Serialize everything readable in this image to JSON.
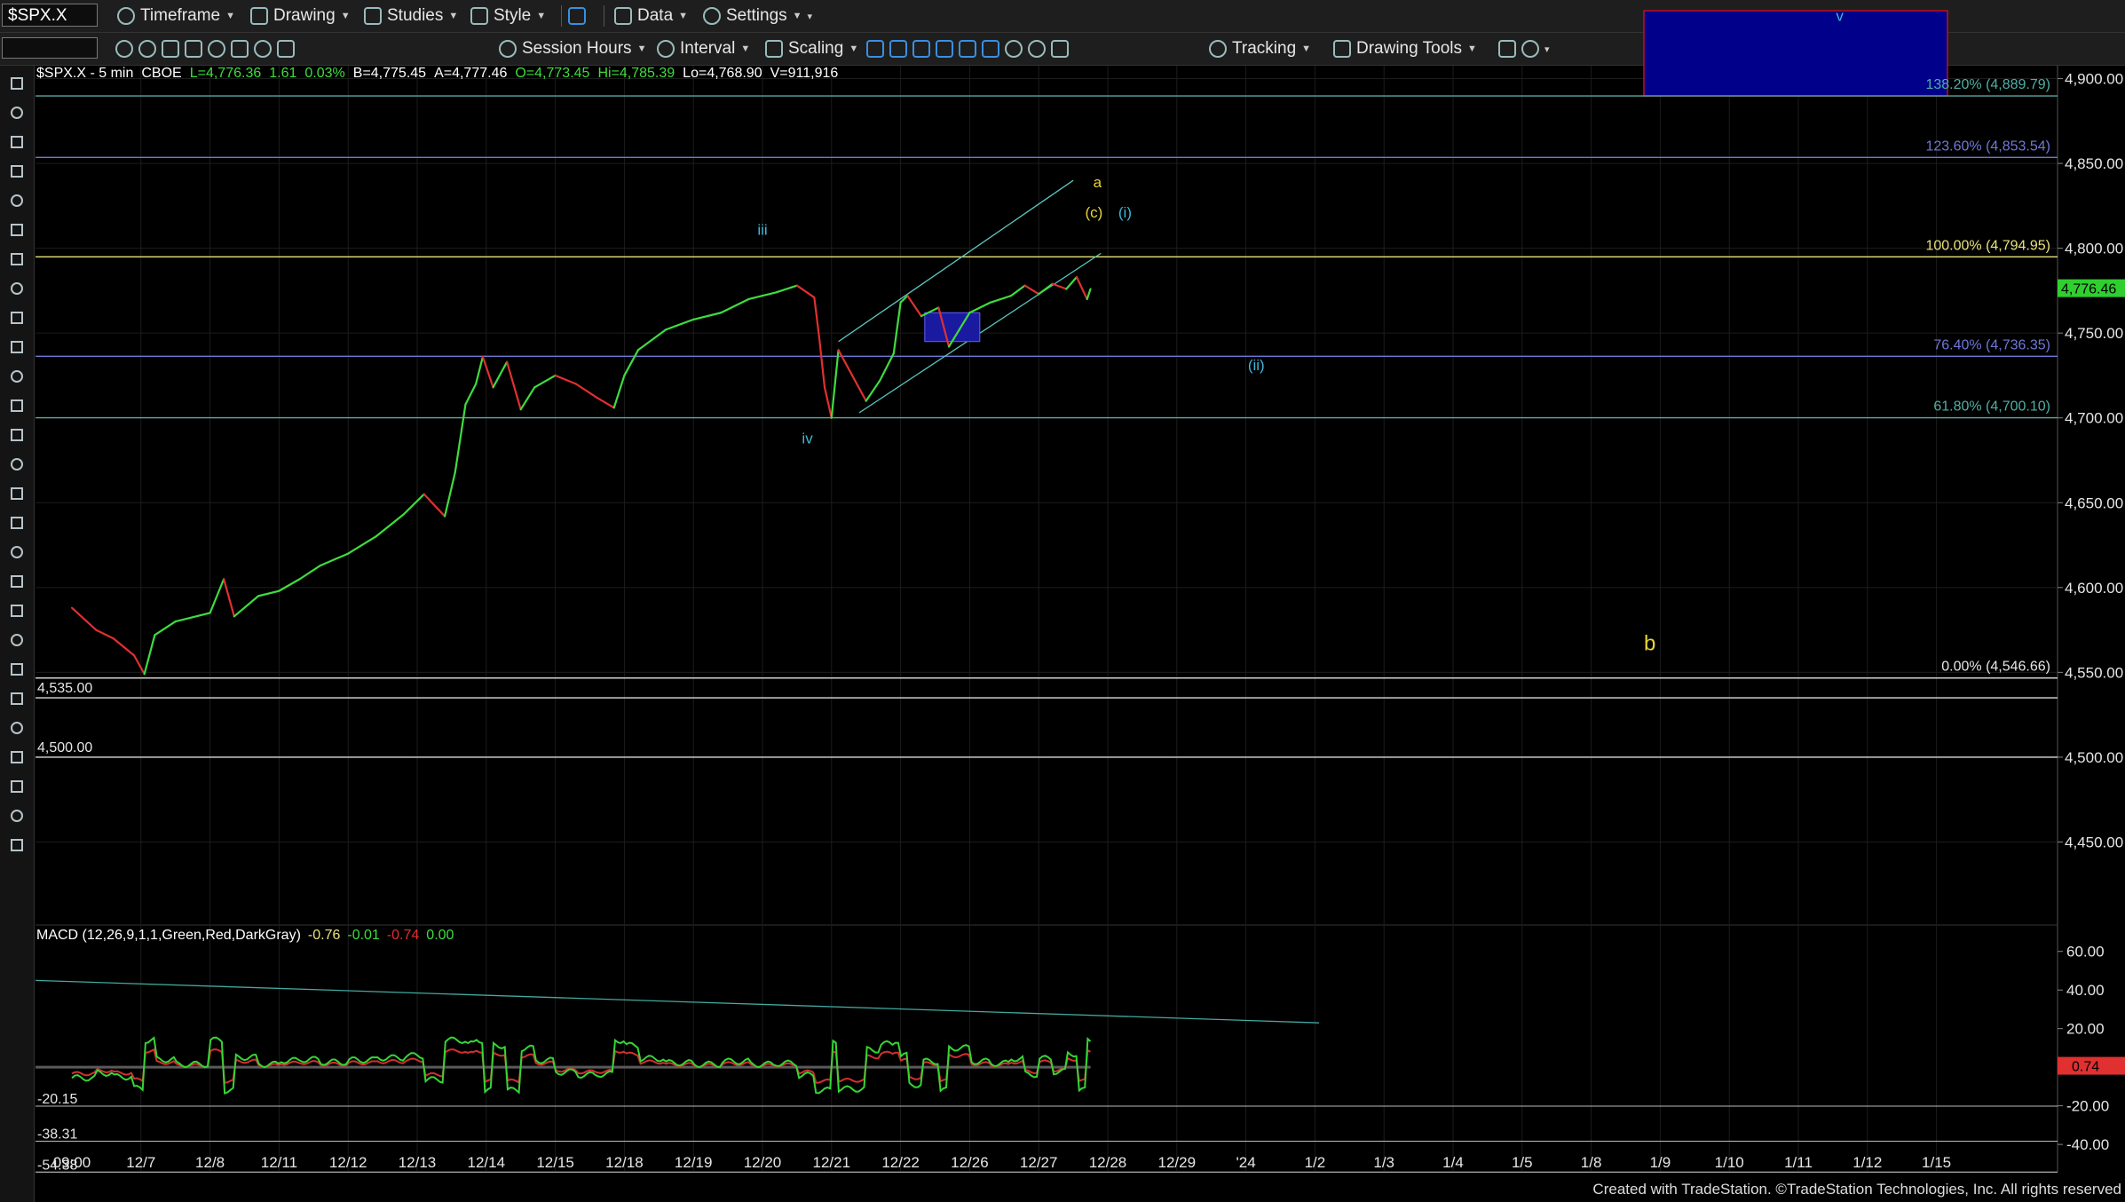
{
  "toolbar1": {
    "symbol": "$SPX.X",
    "items": [
      "Timeframe",
      "Drawing",
      "Studies",
      "Style",
      "Data",
      "Settings"
    ]
  },
  "toolbar2": {
    "items": [
      "Session Hours",
      "Interval",
      "Scaling",
      "Tracking",
      "Drawing Tools"
    ]
  },
  "status": {
    "symbol_interval": "$SPX.X - 5 min",
    "exchange": "CBOE",
    "last": "L=4,776.36",
    "change": "1.61",
    "pct": "0.03%",
    "bid": "B=4,775.45",
    "ask": "A=4,777.46",
    "open": "O=4,773.45",
    "high": "Hi=4,785.39",
    "low": "Lo=4,768.90",
    "volume": "V=911,916"
  },
  "macd_header": {
    "label": "MACD (12,26,9,1,1,Green,Red,DarkGray)",
    "v1": "-0.76",
    "v2": "-0.01",
    "v3": "-0.74",
    "v4": "0.00"
  },
  "footer": "Created with TradeStation. ©TradeStation Technologies, Inc. All rights reserved",
  "colors": {
    "up": "#3fdc3f",
    "down": "#e03030",
    "fib_yellow": "#e8e27a",
    "fib_blue": "#6f78d8",
    "fib_teal": "#5aa9a4",
    "target_box": "#00008a",
    "wave_cyan": "#3fb6d6",
    "wave_yellow": "#e8d43a"
  },
  "chart_data": {
    "type": "line",
    "title": "$SPX.X - 5 min",
    "price_axis": {
      "ylim": [
        4400,
        4950
      ],
      "ticks": [
        "4,900.00",
        "4,850.00",
        "4,800.00",
        "4,750.00",
        "4,700.00",
        "4,650.00",
        "4,600.00",
        "4,550.00",
        "4,500.00",
        "4,450.00"
      ],
      "last_price_label": "4,776.46"
    },
    "time_axis": {
      "ticks": [
        "09:00",
        "12/7",
        "12/8",
        "12/11",
        "12/12",
        "12/13",
        "12/14",
        "12/15",
        "12/18",
        "12/19",
        "12/20",
        "12/21",
        "12/22",
        "12/26",
        "12/27",
        "12/28",
        "12/29",
        "'24",
        "1/2",
        "1/3",
        "1/4",
        "1/5",
        "1/8",
        "1/9",
        "1/10",
        "1/11",
        "1/12",
        "1/15"
      ]
    },
    "series": [
      {
        "name": "$SPX.X",
        "points": [
          [
            0.0,
            4588
          ],
          [
            0.35,
            4575
          ],
          [
            0.6,
            4570
          ],
          [
            0.9,
            4560
          ],
          [
            1.05,
            4549
          ],
          [
            1.2,
            4572
          ],
          [
            1.5,
            4580
          ],
          [
            2.0,
            4585
          ],
          [
            2.2,
            4605
          ],
          [
            2.35,
            4583
          ],
          [
            2.7,
            4595
          ],
          [
            3.0,
            4598
          ],
          [
            3.3,
            4605
          ],
          [
            3.6,
            4613
          ],
          [
            4.0,
            4620
          ],
          [
            4.4,
            4630
          ],
          [
            4.8,
            4643
          ],
          [
            5.1,
            4655
          ],
          [
            5.4,
            4642
          ],
          [
            5.55,
            4668
          ],
          [
            5.7,
            4708
          ],
          [
            5.85,
            4720
          ],
          [
            5.95,
            4736
          ],
          [
            6.1,
            4718
          ],
          [
            6.3,
            4733
          ],
          [
            6.5,
            4705
          ],
          [
            6.7,
            4718
          ],
          [
            7.0,
            4725
          ],
          [
            7.3,
            4720
          ],
          [
            7.6,
            4712
          ],
          [
            7.85,
            4706
          ],
          [
            8.0,
            4725
          ],
          [
            8.2,
            4740
          ],
          [
            8.6,
            4752
          ],
          [
            9.0,
            4758
          ],
          [
            9.4,
            4762
          ],
          [
            9.8,
            4770
          ],
          [
            10.2,
            4774
          ],
          [
            10.5,
            4778
          ],
          [
            10.75,
            4771
          ],
          [
            10.82,
            4748
          ],
          [
            10.9,
            4718
          ],
          [
            11.0,
            4700
          ],
          [
            11.1,
            4740
          ],
          [
            11.3,
            4725
          ],
          [
            11.5,
            4710
          ],
          [
            11.7,
            4722
          ],
          [
            11.9,
            4738
          ],
          [
            12.0,
            4768
          ],
          [
            12.1,
            4772
          ],
          [
            12.3,
            4760
          ],
          [
            12.55,
            4765
          ],
          [
            12.7,
            4742
          ],
          [
            12.85,
            4752
          ],
          [
            13.0,
            4762
          ],
          [
            13.3,
            4768
          ],
          [
            13.6,
            4772
          ],
          [
            13.8,
            4778
          ],
          [
            14.0,
            4773
          ],
          [
            14.2,
            4779
          ],
          [
            14.4,
            4776
          ],
          [
            14.55,
            4783
          ],
          [
            14.7,
            4770
          ],
          [
            14.75,
            4776
          ]
        ]
      }
    ],
    "fib_levels": [
      {
        "label": "138.20% (4,889.79)",
        "price": 4889.79
      },
      {
        "label": "123.60% (4,853.54)",
        "price": 4853.54
      },
      {
        "label": "100.00% (4,794.95)",
        "price": 4794.95
      },
      {
        "label": "76.40% (4,736.35)",
        "price": 4736.35
      },
      {
        "label": "61.80% (4,700.10)",
        "price": 4700.1
      },
      {
        "label": "0.00% (4,546.66)",
        "price": 4546.66
      }
    ],
    "horizontal_lines": [
      {
        "label": "4,535.00",
        "price": 4535.0
      },
      {
        "label": "4,500.00",
        "price": 4500.0
      }
    ],
    "wave_labels": [
      {
        "text": "iii",
        "x": 10.0,
        "price": 4808
      },
      {
        "text": "iv",
        "x": 10.65,
        "price": 4685
      },
      {
        "text": "a",
        "x": 14.85,
        "price": 4836
      },
      {
        "text": "(c)",
        "x": 14.8,
        "price": 4818
      },
      {
        "text": "(i)",
        "x": 15.25,
        "price": 4818
      },
      {
        "text": "(ii)",
        "x": 17.15,
        "price": 4728
      },
      {
        "text": "b",
        "x": 22.85,
        "price": 4563
      },
      {
        "text": "v",
        "x": 25.6,
        "price": 4934
      }
    ],
    "macd": {
      "ylim": [
        -45,
        70
      ],
      "ticks": [
        "60.00",
        "40.00",
        "20.00",
        "-20.00",
        "-40.00"
      ],
      "last_label": "0.74",
      "side_labels": [
        "-20.15",
        "-38.31",
        "-54.38"
      ]
    }
  }
}
